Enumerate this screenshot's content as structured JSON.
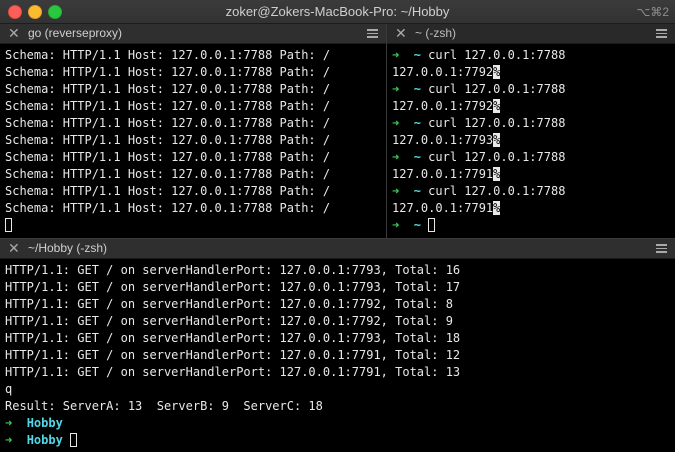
{
  "window": {
    "title": "zoker@Zokers-MacBook-Pro: ~/Hobby",
    "shortcut": "⌥⌘2"
  },
  "pane_left": {
    "title": "go (reverseproxy)",
    "lines": [
      "Schema: HTTP/1.1 Host: 127.0.0.1:7788 Path: /",
      "Schema: HTTP/1.1 Host: 127.0.0.1:7788 Path: /",
      "Schema: HTTP/1.1 Host: 127.0.0.1:7788 Path: /",
      "Schema: HTTP/1.1 Host: 127.0.0.1:7788 Path: /",
      "Schema: HTTP/1.1 Host: 127.0.0.1:7788 Path: /",
      "Schema: HTTP/1.1 Host: 127.0.0.1:7788 Path: /",
      "Schema: HTTP/1.1 Host: 127.0.0.1:7788 Path: /",
      "Schema: HTTP/1.1 Host: 127.0.0.1:7788 Path: /",
      "Schema: HTTP/1.1 Host: 127.0.0.1:7788 Path: /",
      "Schema: HTTP/1.1 Host: 127.0.0.1:7788 Path: /"
    ]
  },
  "pane_right": {
    "title": "~ (-zsh)",
    "prompt_arrow": "➜",
    "prompt_dir": "~",
    "no_eol_mark": "%",
    "entries": [
      {
        "command": "curl 127.0.0.1:7788",
        "output": "127.0.0.1:7792"
      },
      {
        "command": "curl 127.0.0.1:7788",
        "output": "127.0.0.1:7792"
      },
      {
        "command": "curl 127.0.0.1:7788",
        "output": "127.0.0.1:7793"
      },
      {
        "command": "curl 127.0.0.1:7788",
        "output": "127.0.0.1:7791"
      },
      {
        "command": "curl 127.0.0.1:7788",
        "output": "127.0.0.1:7791"
      }
    ]
  },
  "pane_bottom": {
    "title": "~/Hobby (-zsh)",
    "lines": [
      "HTTP/1.1: GET / on serverHandlerPort: 127.0.0.1:7793, Total: 16",
      "HTTP/1.1: GET / on serverHandlerPort: 127.0.0.1:7793, Total: 17",
      "HTTP/1.1: GET / on serverHandlerPort: 127.0.0.1:7792, Total: 8",
      "HTTP/1.1: GET / on serverHandlerPort: 127.0.0.1:7792, Total: 9",
      "HTTP/1.1: GET / on serverHandlerPort: 127.0.0.1:7793, Total: 18",
      "HTTP/1.1: GET / on serverHandlerPort: 127.0.0.1:7791, Total: 12",
      "HTTP/1.1: GET / on serverHandlerPort: 127.0.0.1:7791, Total: 13",
      "q",
      "Result: ServerA: 13  ServerB: 9  ServerC: 18"
    ],
    "prompt_arrow": "➜",
    "prompt_dir": "Hobby"
  },
  "colors": {
    "prompt_arrow": "#36d05a",
    "prompt_dir": "#52d7e6",
    "text": "#e8e8e8",
    "background": "#000000"
  }
}
